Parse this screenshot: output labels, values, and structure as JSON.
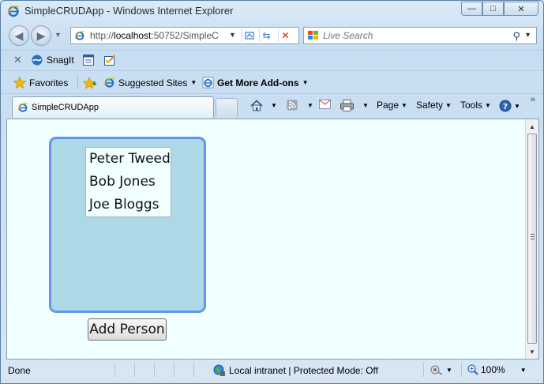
{
  "window": {
    "title": "SimpleCRUDApp - Windows Internet Explorer",
    "minimize_glyph": "—",
    "maximize_glyph": "□",
    "close_glyph": "✕"
  },
  "addressbar": {
    "url_prefix": "http://",
    "url_host": "localhost",
    "url_rest": ":50752/SimpleC"
  },
  "search": {
    "placeholder": "Live Search"
  },
  "snagit_bar": {
    "label": "SnagIt"
  },
  "favorites_bar": {
    "favorites_label": "Favorites",
    "suggested_label": "Suggested Sites",
    "addons_label": "Get More Add-ons"
  },
  "tabs": [
    {
      "label": "SimpleCRUDApp"
    }
  ],
  "commandbar": {
    "page_label": "Page",
    "safety_label": "Safety",
    "tools_label": "Tools"
  },
  "app": {
    "people": [
      "Peter Tweed",
      "Bob Jones",
      "Joe Bloggs"
    ],
    "add_button_label": "Add Person",
    "colors": {
      "page_background": "#f0ffff",
      "panel_background": "#add8e6",
      "panel_border": "#6495ed"
    }
  },
  "statusbar": {
    "status_text": "Done",
    "zone_text": "Local intranet | Protected Mode: Off",
    "zoom_text": "100%"
  }
}
